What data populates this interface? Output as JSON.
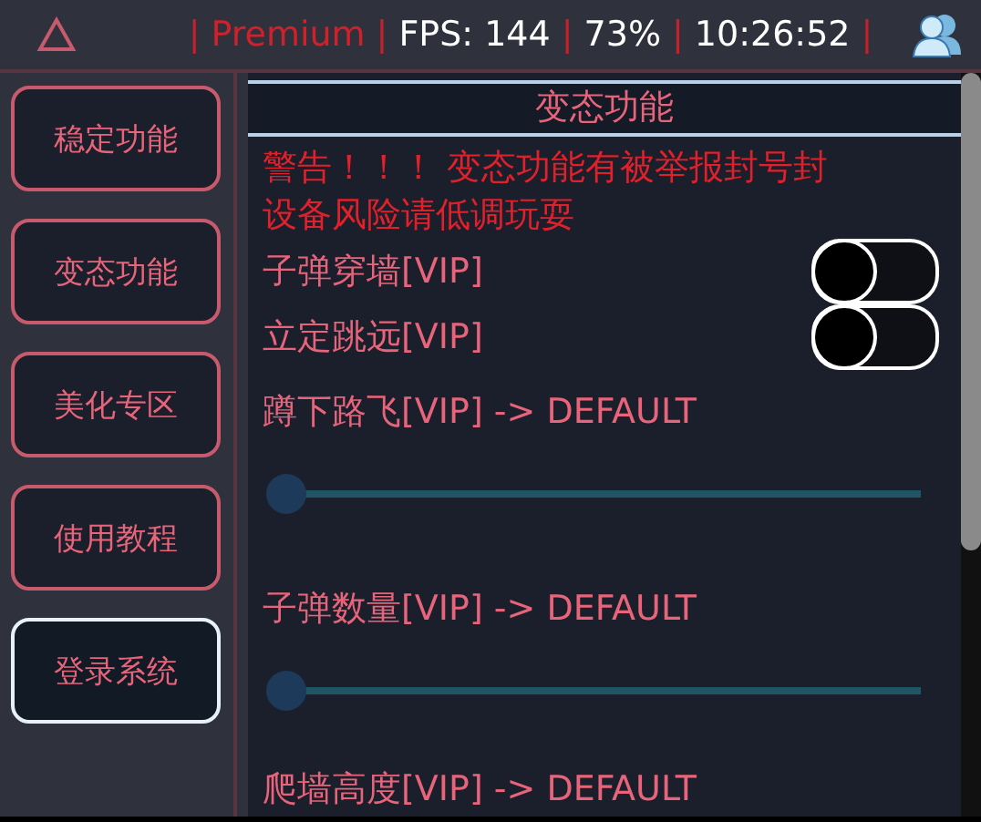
{
  "status_bar": {
    "items": [
      {
        "kind": "separator",
        "text": "|"
      },
      {
        "kind": "premium",
        "text": "Premium"
      },
      {
        "kind": "separator",
        "text": "|"
      },
      {
        "kind": "info",
        "text": "FPS: 144"
      },
      {
        "kind": "separator",
        "text": "|"
      },
      {
        "kind": "info",
        "text": "73%"
      },
      {
        "kind": "separator",
        "text": "|"
      },
      {
        "kind": "info",
        "text": "10:26:52"
      },
      {
        "kind": "separator",
        "text": "|"
      }
    ]
  },
  "sidebar": {
    "items": [
      {
        "label": "稳定功能",
        "selected": false
      },
      {
        "label": "变态功能",
        "selected": false
      },
      {
        "label": "美化专区",
        "selected": false
      },
      {
        "label": "使用教程",
        "selected": false
      },
      {
        "label": "登录系统",
        "selected": true
      }
    ]
  },
  "panel": {
    "title": "变态功能",
    "warning": "警告！！！ 变态功能有被举报封号封设备风险请低调玩耍",
    "rows": [
      {
        "kind": "toggle",
        "label": "子弹穿墙[VIP]",
        "on": false
      },
      {
        "kind": "toggle",
        "label": "立定跳远[VIP]",
        "on": false
      },
      {
        "kind": "slider",
        "label": "蹲下路飞[VIP] -> DEFAULT",
        "level": 0
      },
      {
        "kind": "slider",
        "label": "子弹数量[VIP] -> DEFAULT",
        "level": 0
      },
      {
        "kind": "label",
        "label": "爬墙高度[VIP] -> DEFAULT"
      }
    ]
  }
}
